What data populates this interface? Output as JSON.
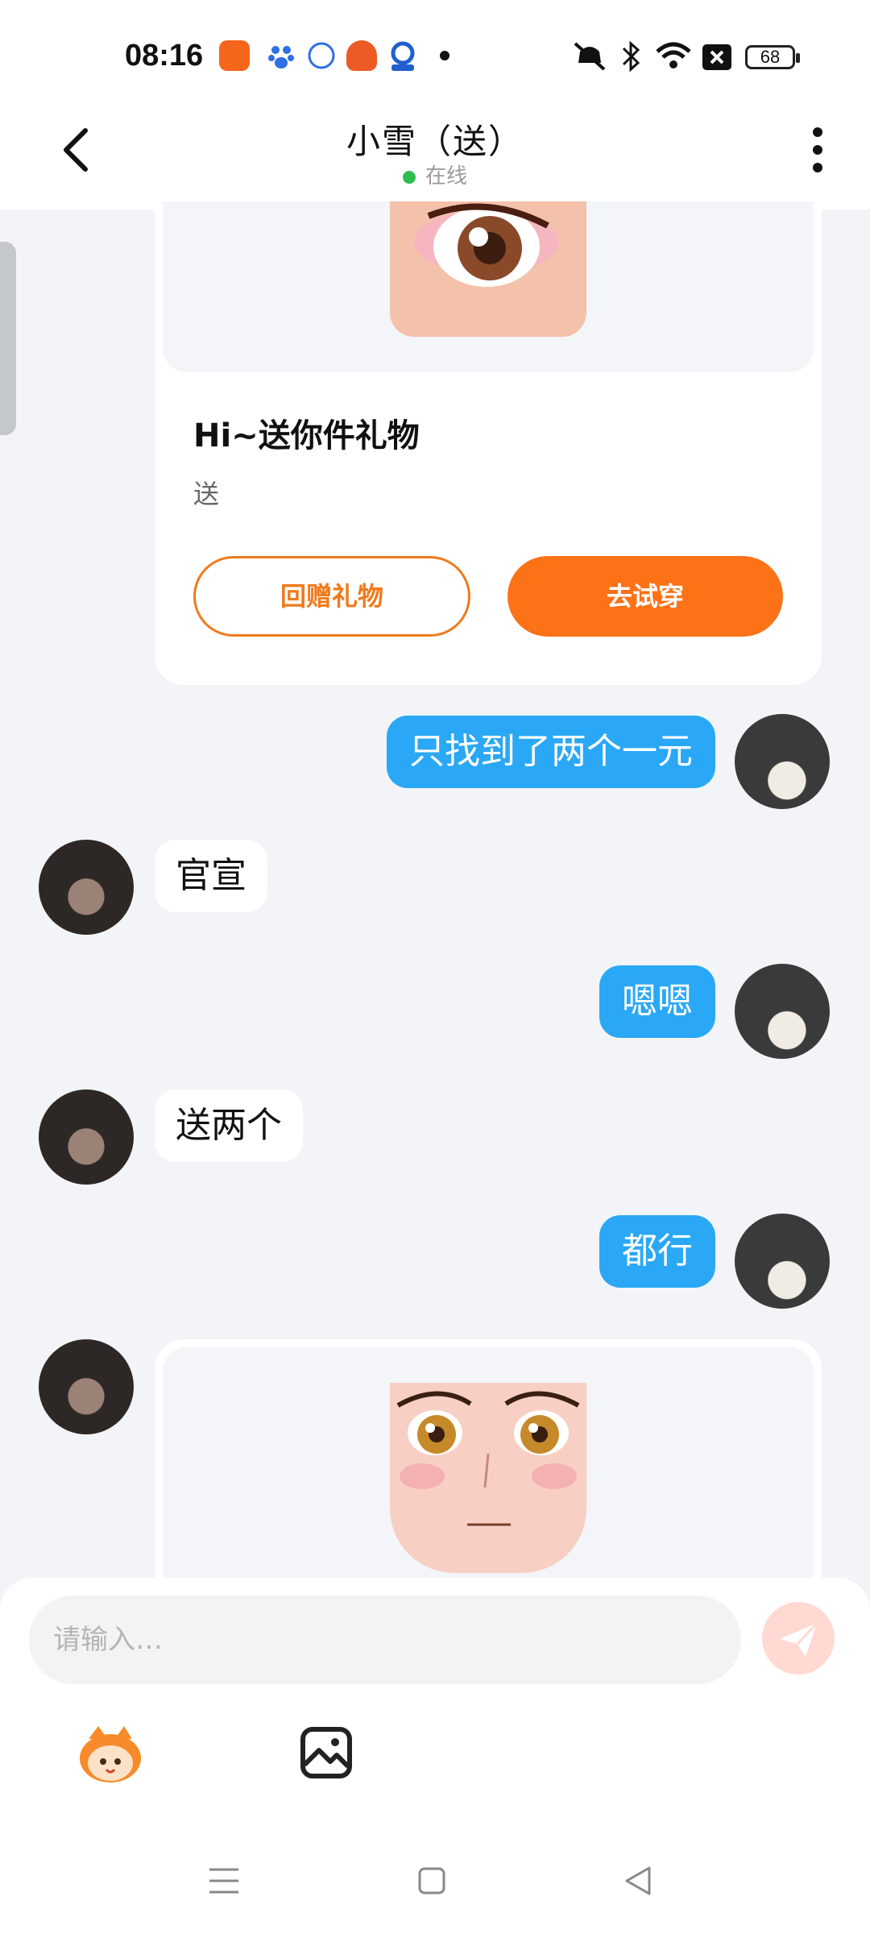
{
  "status_bar": {
    "time": "08:16",
    "battery": "68",
    "icons": [
      "app-icon-orange",
      "paw-icon",
      "ifly-icon",
      "fish-icon",
      "shield-app-icon",
      "mute-icon",
      "bluetooth-icon",
      "wifi-icon",
      "close-box-icon",
      "battery-icon"
    ]
  },
  "header": {
    "title": "小雪（送）",
    "status": "在线"
  },
  "gift_card": {
    "title": "Hi~送你件礼物",
    "subtitle": "送",
    "return_gift_label": "回赠礼物",
    "try_on_label": "去试穿",
    "image_name": "avatar-eye-image"
  },
  "messages": [
    {
      "side": "out",
      "text": "只找到了两个一元"
    },
    {
      "side": "in",
      "text": "官宣"
    },
    {
      "side": "out",
      "text": "嗯嗯"
    },
    {
      "side": "in",
      "text": "送两个"
    },
    {
      "side": "out",
      "text": "都行"
    }
  ],
  "input": {
    "placeholder": "请输入…"
  },
  "toolbar": {
    "items": [
      "sticker-icon",
      "image-icon"
    ]
  },
  "colors": {
    "accent": "#fc7217",
    "bubble_out": "#2aa8f5",
    "online": "#2dbd4f"
  }
}
